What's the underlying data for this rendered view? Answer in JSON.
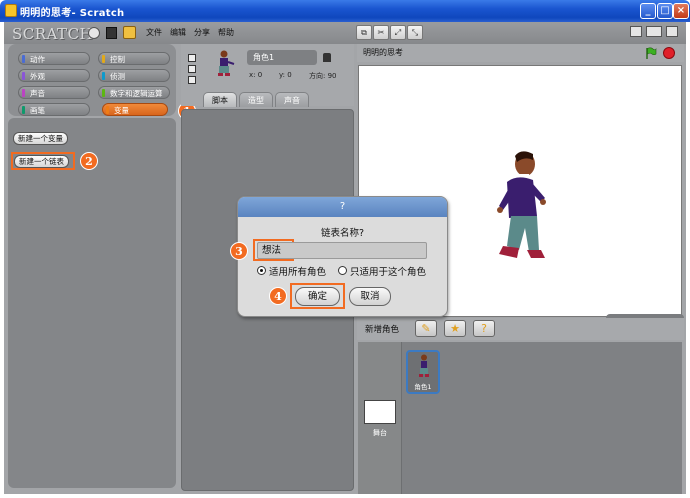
{
  "window": {
    "title": "明明的思考- Scratch",
    "controls": [
      "minimize-icon",
      "maximize-icon",
      "close-icon"
    ]
  },
  "menubar": {
    "logo": "SCRATCH",
    "items": [
      "文件",
      "编辑",
      "分享",
      "帮助"
    ]
  },
  "categories": [
    {
      "label": "动作",
      "color": "#4a6cd4"
    },
    {
      "label": "控制",
      "color": "#e1a91a"
    },
    {
      "label": "外观",
      "color": "#8a55d7"
    },
    {
      "label": "侦测",
      "color": "#0e9acc"
    },
    {
      "label": "声音",
      "color": "#bb42c3"
    },
    {
      "label": "数字和逻辑运算",
      "color": "#5cb712"
    },
    {
      "label": "画笔",
      "color": "#0e9a6c"
    },
    {
      "label": "变量",
      "color": "#ee7d16"
    }
  ],
  "palette": {
    "new_variable": "新建一个变量",
    "new_list": "新建一个链表"
  },
  "sprite": {
    "name": "角色1",
    "x": "x: 0",
    "y": "y: 0",
    "direction": "方向: 90",
    "tabs": [
      "脚本",
      "造型",
      "声音"
    ]
  },
  "stage": {
    "title": "明明的思考",
    "mouse_x": "x: -51",
    "mouse_y": "y: 237"
  },
  "sprite_list": {
    "new_sprite_label": "新增角色",
    "sprite_name": "角色1",
    "stage_label": "舞台"
  },
  "dialog": {
    "title": "?",
    "prompt": "链表名称?",
    "input_value": "想法",
    "option_all": "适用所有角色",
    "option_this": "只适用于这个角色",
    "ok": "确定",
    "cancel": "取消"
  },
  "callouts": [
    "1",
    "2",
    "3",
    "4"
  ],
  "accent_color": "#f26b21"
}
